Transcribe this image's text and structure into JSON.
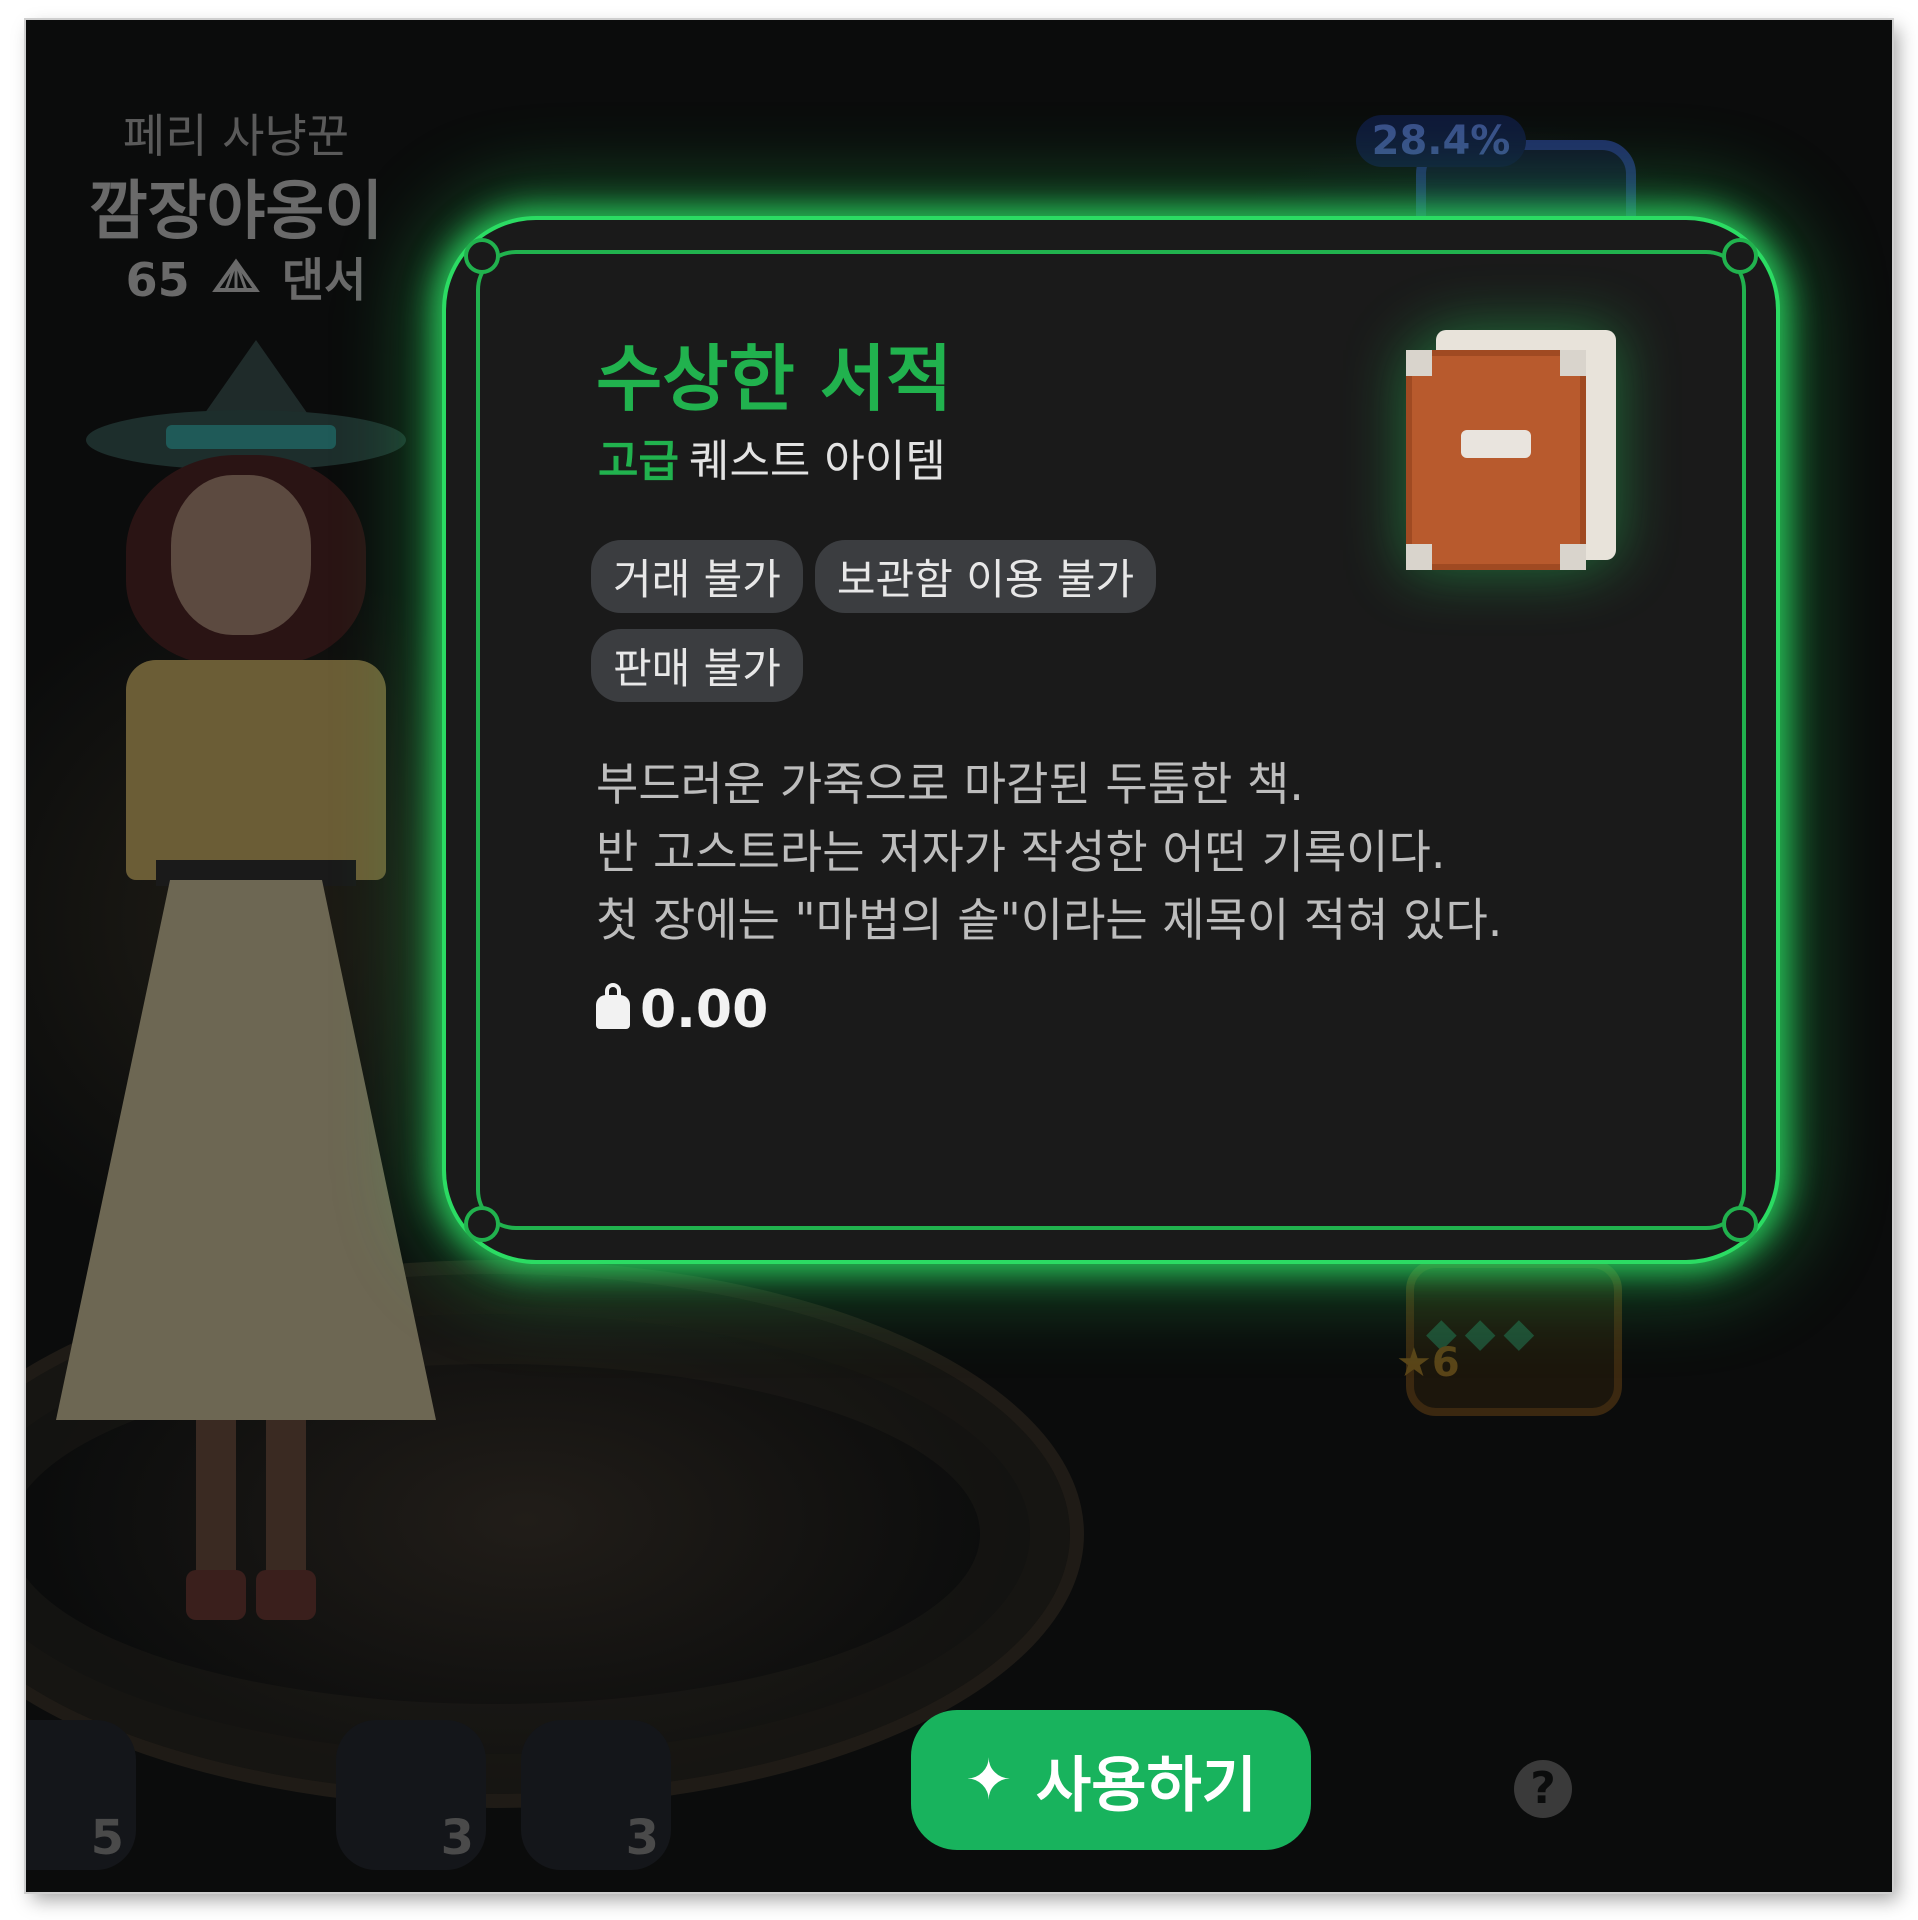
{
  "character": {
    "title": "페리 사냥꾼",
    "name": "깜장야옹이",
    "level": "65",
    "class": "댄서",
    "class_icon": "fan-icon"
  },
  "background": {
    "percent_badge": "28.4%",
    "orange_slot_star": "★6",
    "bottom_slots": [
      {
        "count": "5"
      },
      {
        "count": "3"
      },
      {
        "count": "3"
      }
    ],
    "help_label": "?"
  },
  "item": {
    "name": "수상한 서적",
    "grade": "고급",
    "type": "퀘스트 아이템",
    "tags": [
      "거래 불가",
      "보관함 이용 불가",
      "판매 불가"
    ],
    "description": [
      "부드러운 가죽으로 마감된 두툼한 책.",
      "반 고스트라는 저자가 작성한 어떤 기록이다.",
      "첫 장에는 \"마법의 솥\"이라는 제목이 적혀 있다."
    ],
    "weight": "0.00",
    "icon": "book-icon"
  },
  "actions": {
    "use_label": "사용하기",
    "use_icon": "sparkle-icon"
  },
  "colors": {
    "accent_green": "#21b24e",
    "glow_green": "#2bdc63",
    "button_green": "#18b35d",
    "dialog_bg": "#1a1a1a"
  }
}
